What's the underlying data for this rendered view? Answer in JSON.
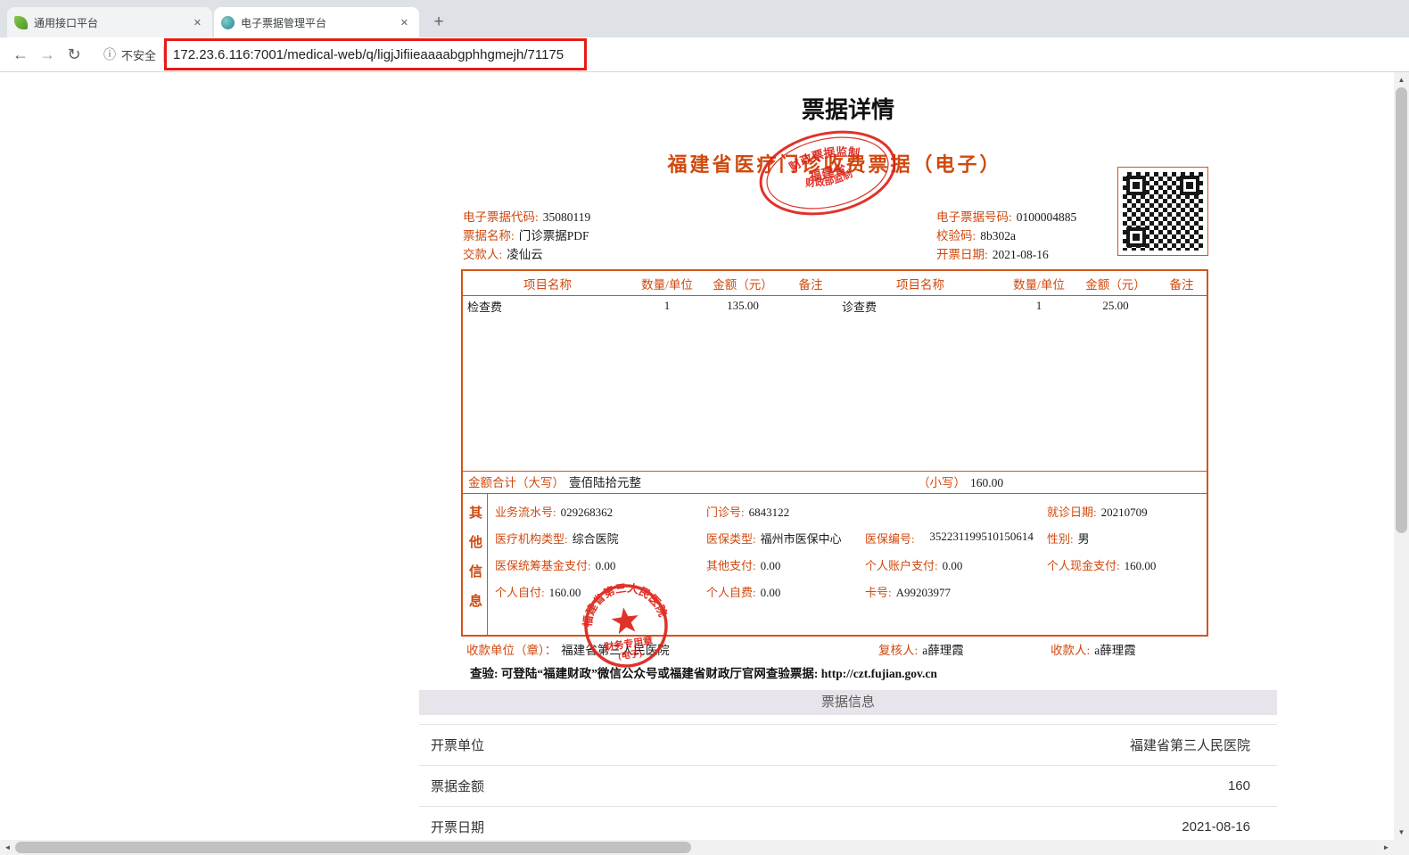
{
  "colors": {
    "invoice_accent": "#d4541c",
    "stamp_red": "#dd2218",
    "annotation_red": "#e51c16",
    "section_header_bg": "#e9e4ec"
  },
  "browser": {
    "tabs": [
      {
        "title": "通用接口平台"
      },
      {
        "title": "电子票据管理平台"
      }
    ],
    "new_tab_label": "+",
    "security_label": "不安全",
    "url": "172.23.6.116:7001/medical-web/q/ligjJifiieaaaabgphhgmejh/71175"
  },
  "page": {
    "title": "票据详情"
  },
  "invoice": {
    "title": "福建省医疗门诊收费票据（电子）",
    "header_left": [
      {
        "label": "电子票据代码:",
        "value": "35080119"
      },
      {
        "label": "票据名称:",
        "value": "门诊票据PDF"
      },
      {
        "label": "交款人:",
        "value": "凌仙云"
      }
    ],
    "header_right": [
      {
        "label": "电子票据号码:",
        "value": "0100004885"
      },
      {
        "label": "校验码:",
        "value": "8b302a"
      },
      {
        "label": "开票日期:",
        "value": "2021-08-16"
      }
    ],
    "items": {
      "headers": [
        "项目名称",
        "数量/单位",
        "金额（元）",
        "备注",
        "项目名称",
        "数量/单位",
        "金额（元）",
        "备注"
      ],
      "row": [
        "检查费",
        "1",
        "135.00",
        "",
        "诊查费",
        "1",
        "25.00",
        ""
      ]
    },
    "total": {
      "label_upper": "金额合计（大写）",
      "amount_upper": "壹佰陆拾元整",
      "label_lower": "（小写）",
      "amount_lower": "160.00"
    },
    "other_info": {
      "side_label": "其他信息",
      "fields": [
        {
          "label": "业务流水号:",
          "value": "029268362"
        },
        {
          "label": "门诊号:",
          "value": "6843122"
        },
        {
          "label": "就诊日期:",
          "value": "20210709"
        },
        {
          "label": "医疗机构类型:",
          "value": "综合医院"
        },
        {
          "label": "医保类型:",
          "value": "福州市医保中心"
        },
        {
          "label": "医保编号:",
          "value": "352231199510150614"
        },
        {
          "label": "性别:",
          "value": "男"
        },
        {
          "label": "医保统筹基金支付:",
          "value": "0.00"
        },
        {
          "label": "其他支付:",
          "value": "0.00"
        },
        {
          "label": "个人账户支付:",
          "value": "0.00"
        },
        {
          "label": "个人现金支付:",
          "value": "160.00"
        },
        {
          "label": "个人自付:",
          "value": "160.00"
        },
        {
          "label": "个人自费:",
          "value": "0.00"
        },
        {
          "label": "卡号:",
          "value": "A99203977"
        }
      ]
    },
    "footer": [
      {
        "label": "收款单位（章）：",
        "value": "福建省第三人民医院"
      },
      {
        "label": "复核人:",
        "value": "a薛理霞"
      },
      {
        "label": "收款人:",
        "value": "a薛理霞"
      }
    ],
    "verify_note": "查验: 可登陆“福建财政”微信公众号或福建省财政厅官网查验票据: http://czt.fujian.gov.cn",
    "stamps": {
      "oval": {
        "top": "财政票据监制",
        "middle": "福建省",
        "bottom": "财政部监制"
      },
      "round": {
        "ring": "福建省第三人民医院",
        "line1": "财务专用章",
        "line2": "(电子)"
      }
    }
  },
  "info_section": {
    "header": "票据信息",
    "rows": [
      {
        "label": "开票单位",
        "value": "福建省第三人民医院"
      },
      {
        "label": "票据金额",
        "value": "160"
      },
      {
        "label": "开票日期",
        "value": "2021-08-16"
      }
    ]
  }
}
